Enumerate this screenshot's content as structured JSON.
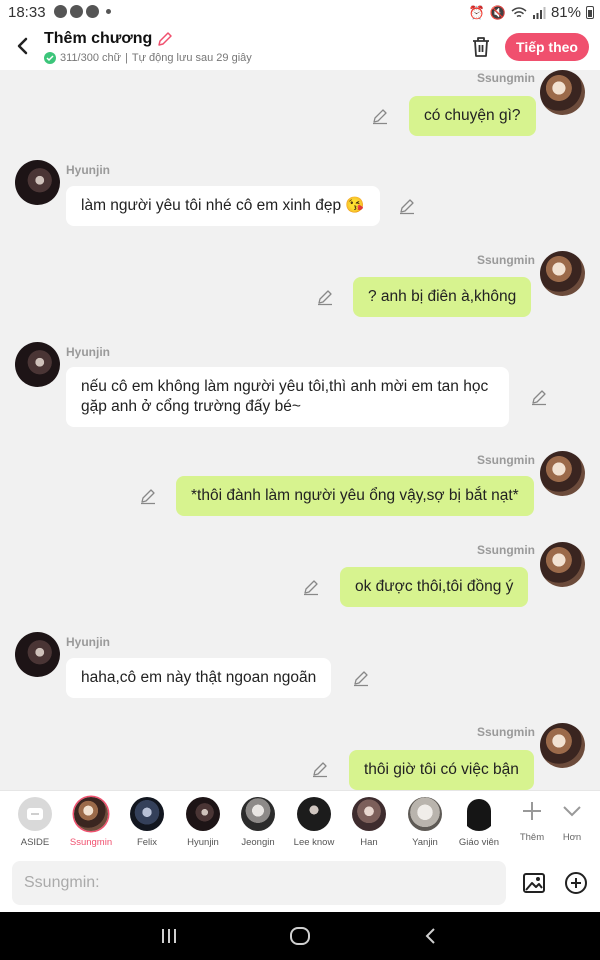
{
  "status_bar": {
    "time": "18:33",
    "battery": "81%"
  },
  "header": {
    "title": "Thêm chương",
    "word_count": "311/300 chữ",
    "autosave": "Tự động lưu sau 29 giây",
    "next_label": "Tiếp theo"
  },
  "messages": [
    {
      "sender": "Ssungmin",
      "side": "right",
      "text": "có chuyện gì?"
    },
    {
      "sender": "Hyunjin",
      "side": "left",
      "text": "làm người yêu tôi nhé cô em xinh đẹp 😘"
    },
    {
      "sender": "Ssungmin",
      "side": "right",
      "text": "? anh bị điên à,không"
    },
    {
      "sender": "Hyunjin",
      "side": "left",
      "text": "nếu cô em không làm người yêu tôi,thì anh mời em tan học gặp anh ở cổng trường đấy bé~"
    },
    {
      "sender": "Ssungmin",
      "side": "right",
      "text": "*thôi đành làm người yêu ổng vậy,sợ bị bắt nạt*"
    },
    {
      "sender": "Ssungmin",
      "side": "right",
      "text": "ok được thôi,tôi đồng ý"
    },
    {
      "sender": "Hyunjin",
      "side": "left",
      "text": "haha,cô em này thật ngoan ngoãn"
    },
    {
      "sender": "Ssungmin",
      "side": "right",
      "text": "thôi giờ tôi có việc bận"
    }
  ],
  "characters": [
    {
      "label": "ASIDE"
    },
    {
      "label": "Ssungmin",
      "active": true
    },
    {
      "label": "Felix"
    },
    {
      "label": "Hyunjin"
    },
    {
      "label": "Jeongin"
    },
    {
      "label": "Lee know"
    },
    {
      "label": "Han"
    },
    {
      "label": "Yanjin"
    },
    {
      "label": "Giáo viên"
    }
  ],
  "tools": {
    "add_label": "Thêm",
    "more_label": "Hơn"
  },
  "composer": {
    "placeholder": "Ssungmin:"
  },
  "colors": {
    "accent": "#f0506e",
    "my_bubble": "#d7f38f",
    "their_bubble": "#ffffff",
    "background": "#f1f1f1"
  },
  "icons": {
    "back": "chevron-left-icon",
    "edit": "pencil-icon",
    "trash": "trash-icon",
    "image": "image-icon",
    "plus": "plus-circle-icon",
    "add": "plus-icon",
    "more": "chevron-down-icon"
  }
}
